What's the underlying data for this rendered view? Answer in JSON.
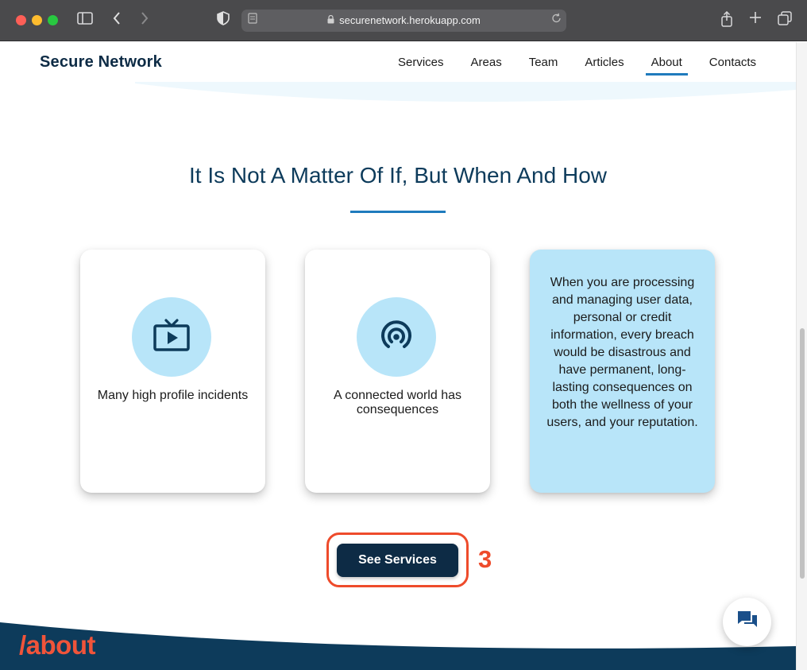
{
  "browser": {
    "url": "securenetwork.herokuapp.com"
  },
  "site": {
    "logo": "Secure Network",
    "nav": [
      {
        "label": "Services"
      },
      {
        "label": "Areas"
      },
      {
        "label": "Team"
      },
      {
        "label": "Articles"
      },
      {
        "label": "About",
        "active": true
      },
      {
        "label": "Contacts"
      }
    ]
  },
  "section": {
    "heading": "It Is Not A Matter Of If, But When And How",
    "cards": [
      {
        "icon": "tv-play-icon",
        "text": "Many high profile incidents"
      },
      {
        "icon": "broadcast-icon",
        "text": "A connected world has consequences"
      },
      {
        "text": "When you are processing and managing user data, personal or credit information, every breach would be disastrous and have permanent, long-lasting consequences on both the wellness of your users, and your reputation."
      }
    ],
    "cta_label": "See Services",
    "annotation_number": "3"
  },
  "footer": {
    "tag": "/about"
  },
  "colors": {
    "navy": "#0d2b45",
    "accent_blue": "#1f7bbd",
    "light_blue": "#b8e5f9",
    "annotation_red": "#ee4b2b",
    "about_orange": "#f0543a"
  }
}
